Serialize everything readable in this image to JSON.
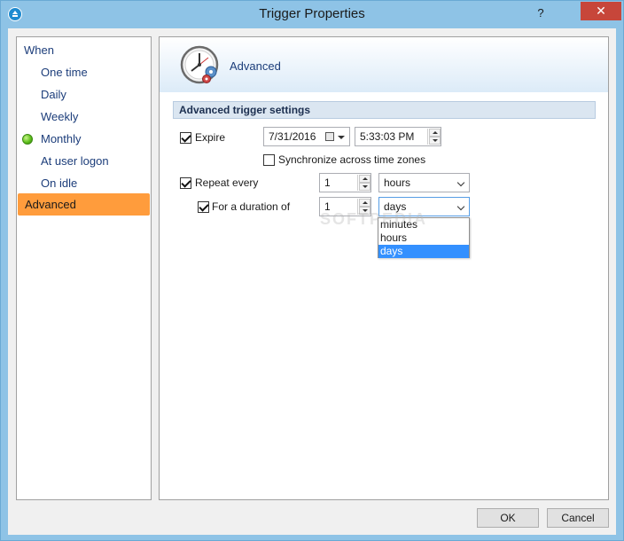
{
  "window": {
    "title": "Trigger Properties",
    "help_label": "?",
    "close_label": "✕"
  },
  "sidebar": {
    "items": [
      {
        "label": "When"
      },
      {
        "label": "One time"
      },
      {
        "label": "Daily"
      },
      {
        "label": "Weekly"
      },
      {
        "label": "Monthly",
        "status": "configured"
      },
      {
        "label": "At user logon"
      },
      {
        "label": "On idle"
      },
      {
        "label": "Advanced",
        "selected": true
      }
    ]
  },
  "main": {
    "header_title": "Advanced",
    "section_title": "Advanced trigger settings",
    "expire": {
      "label": "Expire",
      "checked": true,
      "date": "7/31/2016",
      "time": "5:33:03 PM"
    },
    "sync": {
      "label": "Synchronize across time zones",
      "checked": false
    },
    "repeat": {
      "label": "Repeat every",
      "checked": true,
      "value": "1",
      "unit": "hours"
    },
    "duration": {
      "label": "For a duration of",
      "checked": true,
      "value": "1",
      "unit": "days",
      "options": [
        "minutes",
        "hours",
        "days"
      ],
      "selected_option": "days"
    }
  },
  "watermark": "SOFTPEDIA",
  "footer": {
    "ok_label": "OK",
    "cancel_label": "Cancel"
  },
  "colors": {
    "selection_accent": "#ff9c3c",
    "titlebar_bg": "#8ec3e6",
    "close_button": "#c7463a",
    "dropdown_highlight": "#3390ff"
  }
}
